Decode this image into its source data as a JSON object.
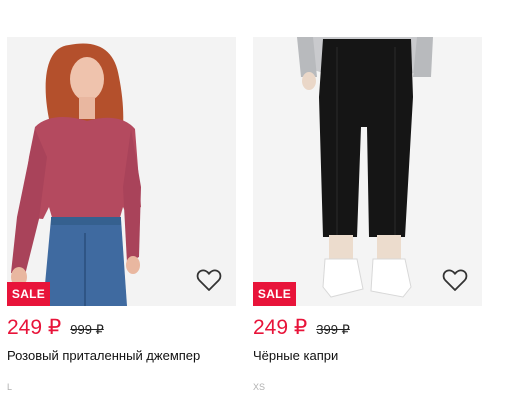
{
  "products": [
    {
      "badge": "SALE",
      "price": "249 ₽",
      "old_price": "999 ₽",
      "title": "Розовый приталенный джемпер",
      "size": "L",
      "favorite_icon": "heart-outline-icon"
    },
    {
      "badge": "SALE",
      "price": "249 ₽",
      "old_price": "399 ₽",
      "title": "Чёрные капри",
      "size": "XS",
      "favorite_icon": "heart-outline-icon"
    }
  ],
  "colors": {
    "sale_badge": "#e8143a",
    "price": "#e8143a",
    "size_text": "#b0b0b0",
    "photo_bg": "#f2f2f2"
  }
}
